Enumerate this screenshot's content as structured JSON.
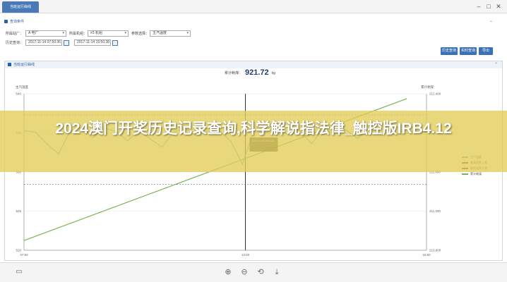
{
  "window": {
    "tab_label": "当班运行曲线",
    "minimize": "–",
    "restore": "□",
    "close": "✕"
  },
  "query_panel": {
    "title": "查询条件",
    "fields": {
      "area_label": "所属站厂：",
      "area_value": "A 电厂",
      "bin_label": "所属机组：",
      "bin_value": "#3 机组",
      "param_label": "参数选择：",
      "param_value": "主汽温度",
      "time_label": "历史查询：",
      "start_time": "2017-11-14 07:50:36",
      "end_time": "2017-11-14 15:50:38"
    },
    "buttons": {
      "history": "历史查询",
      "realtime": "实时查询",
      "export": "导出"
    }
  },
  "chart_panel": {
    "title": "当班运行曲线",
    "stat_label": "累计耗煤：",
    "stat_value": "921.72",
    "stat_unit": "kg"
  },
  "chart_data": {
    "type": "line",
    "ylabel_left": "主汽温度",
    "ylabel_right": "累计耗煤",
    "left_ticks": [
      "540",
      "535",
      "530",
      "525",
      "520"
    ],
    "right_ticks": [
      "212,400",
      "212,000",
      "211,600",
      "211,200",
      "210,800"
    ],
    "x_ticks": [
      "07:50",
      "13:00",
      "15:50"
    ],
    "ylim_left": [
      520,
      540
    ],
    "ylim_right": [
      210800,
      212400
    ],
    "annotation": "2017-11-14 15:11:38",
    "series": [
      {
        "name": "主汽温度",
        "color": "#5aa8d6"
      },
      {
        "name": "最高报警上限",
        "color": "#4a4a4a"
      },
      {
        "name": "最低报警下限",
        "color": "#4a4a4a"
      },
      {
        "name": "累计耗煤",
        "color": "#7ab357"
      }
    ],
    "coal_values": [
      210900,
      212350
    ],
    "temp_values": [
      535.3,
      535.1,
      533.6,
      532.3,
      535.2,
      535.7,
      534.4,
      535.6,
      535.2,
      534.0,
      535.3,
      534.2,
      533.2,
      535.1,
      535.6,
      534.6,
      535.2,
      535.3,
      533.9,
      531.0,
      535.4,
      535.0,
      535.8,
      534.7,
      535.3,
      533.6,
      535.5,
      534.9,
      535.4,
      534.3,
      535.6,
      535.0,
      535.1,
      534.7,
      535.4,
      535.0
    ]
  },
  "overlay": {
    "headline": "2024澳门开奖历史记录查询,科学解说指法律_触控版IRB4.12"
  },
  "toolbar": {
    "icons": [
      "monitor-icon",
      "zoom-in-icon",
      "zoom-out-icon",
      "reset-icon",
      "download-icon"
    ]
  }
}
